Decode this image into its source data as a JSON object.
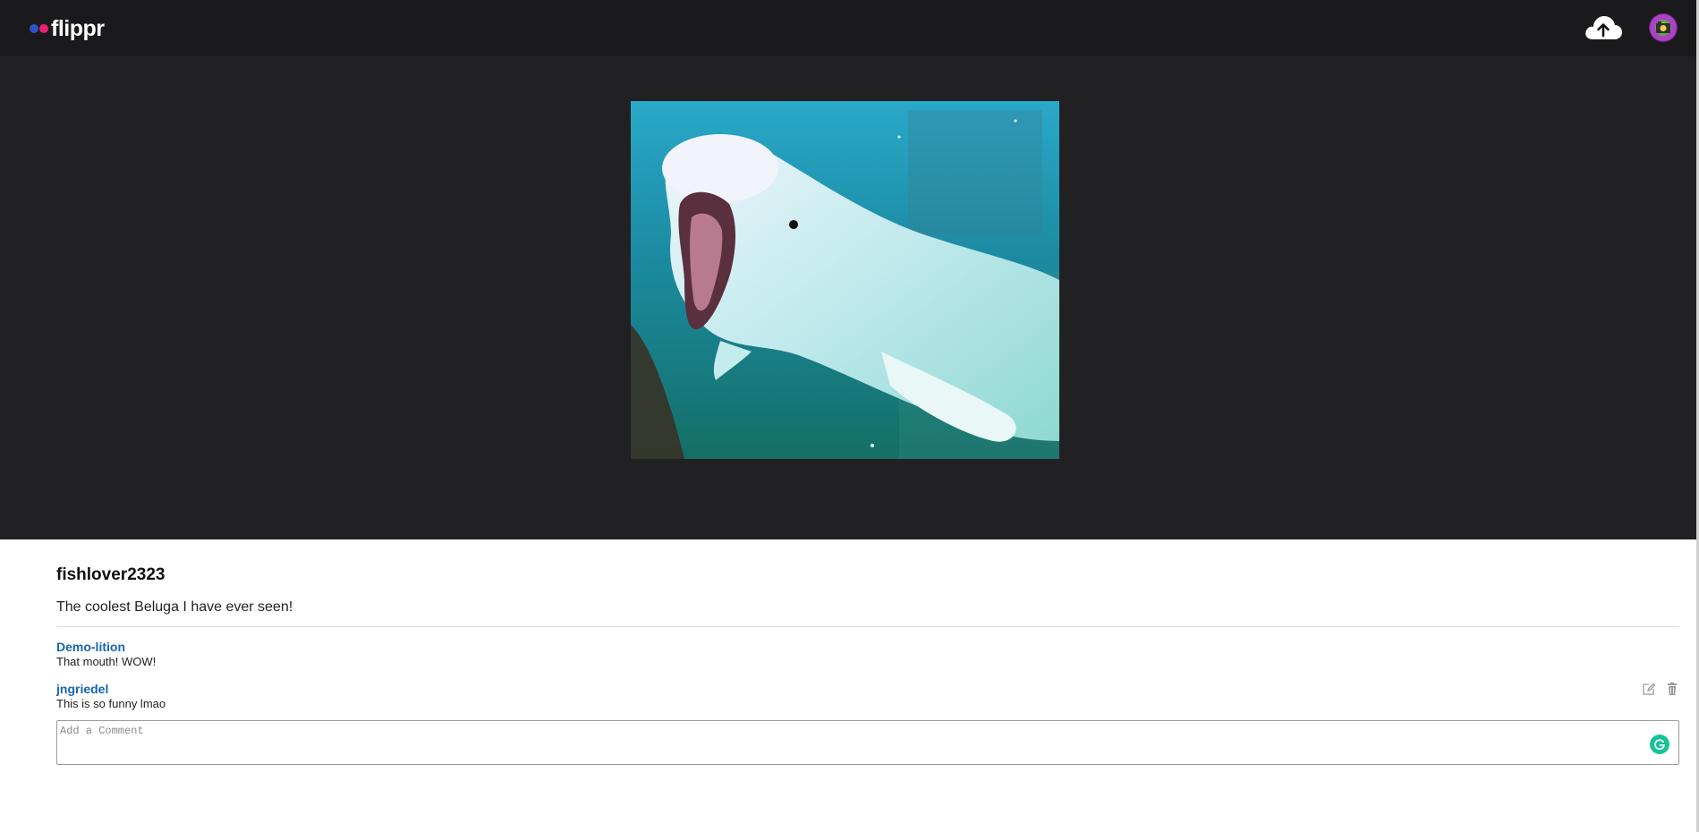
{
  "app": {
    "name": "flippr",
    "brand_colors": {
      "blue": "#2d52c9",
      "pink": "#ec1e74"
    }
  },
  "header": {
    "upload_icon": "cloud-upload-icon",
    "avatar_icon": "user-avatar"
  },
  "photo": {
    "subject": "beluga whale"
  },
  "post": {
    "owner": "fishlover2323",
    "caption": "The coolest Beluga I have ever seen!"
  },
  "comments": [
    {
      "user": "Demo-lition",
      "text": "That mouth! WOW!",
      "editable": false
    },
    {
      "user": "jngriedel",
      "text": "This is so funny lmao",
      "editable": true
    }
  ],
  "comment_input": {
    "placeholder": "Add a Comment",
    "value": ""
  },
  "colors": {
    "header_bg": "#1a1a1c",
    "stage_bg": "#212124",
    "link": "#1566b0",
    "grammarly": "#15c39a"
  }
}
